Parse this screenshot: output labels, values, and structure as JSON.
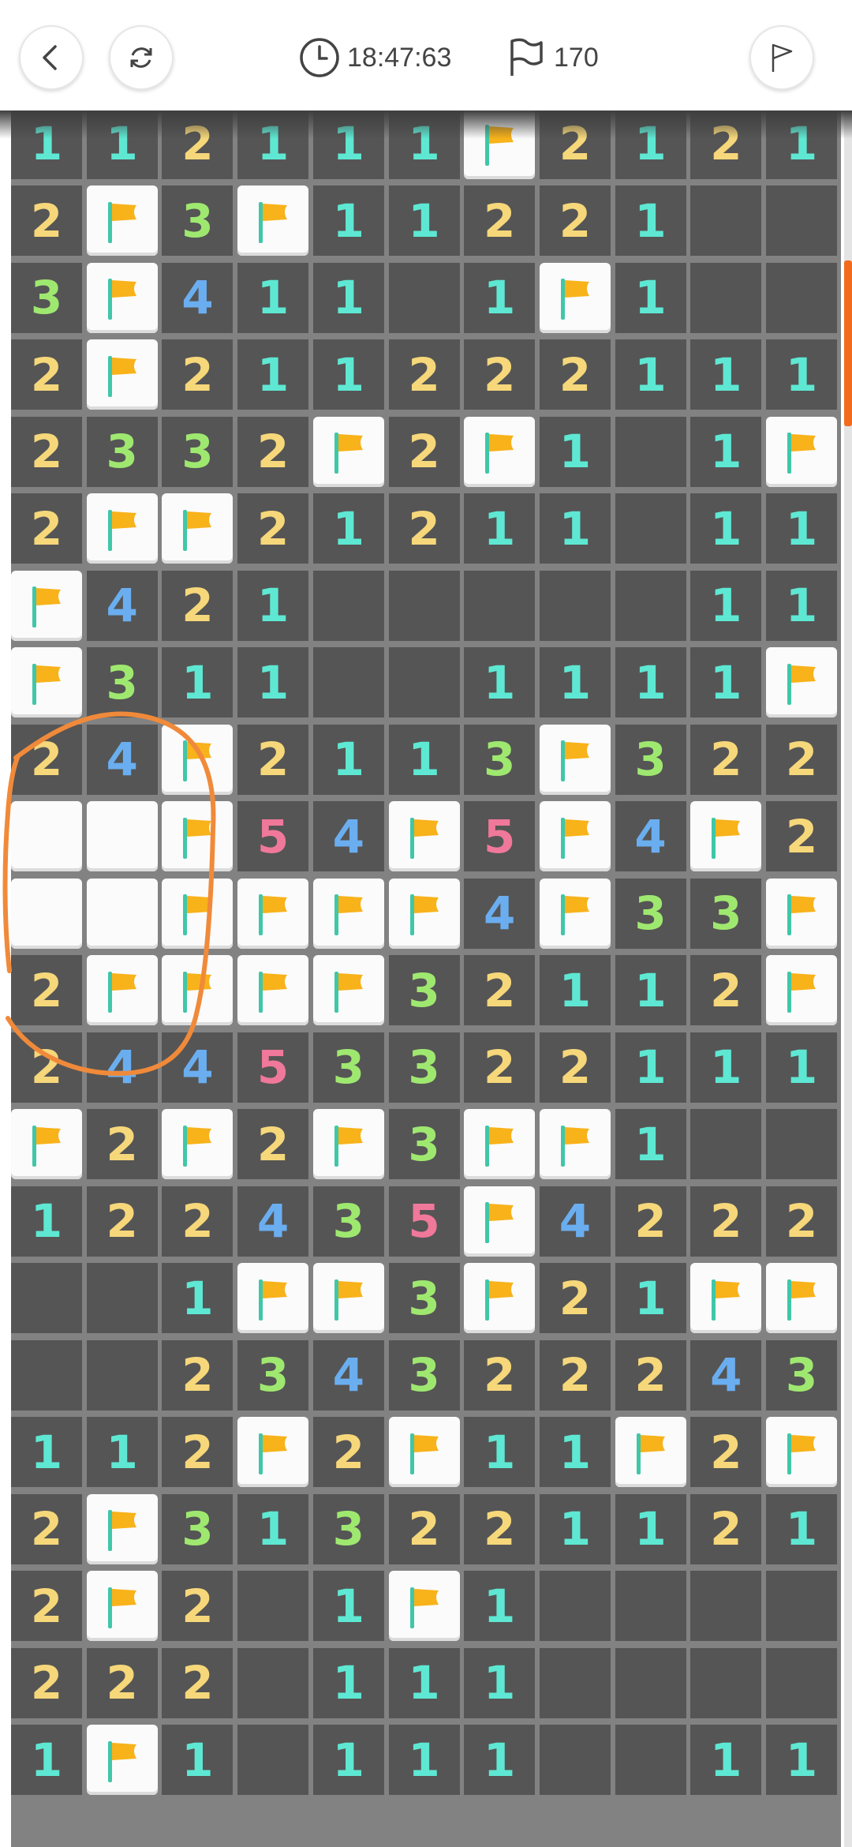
{
  "header": {
    "back_icon": "chevron-left-icon",
    "restart_icon": "refresh-icon",
    "timer_icon": "clock-icon",
    "timer": "18:47:63",
    "flag_icon": "flag-outline-icon",
    "flag_count": "170",
    "flag_mode_icon": "flag-outline-icon"
  },
  "colors": {
    "1": "#5ee8d3",
    "2": "#f6d77a",
    "3": "#9fe870",
    "4": "#6aaef0",
    "5": "#f0789a",
    "open": "#555555",
    "grid": "#828282",
    "accent": "#f26b1d",
    "flag": "#f8b21a",
    "annotation": "#f08a3a"
  },
  "board": {
    "rows": [
      [
        "1",
        "1",
        "2",
        "1",
        "1",
        "1",
        "F",
        "2",
        "1",
        "2",
        "1"
      ],
      [
        "2",
        "F",
        "3",
        "F",
        "1",
        "1",
        "2",
        "2",
        "1",
        "",
        ""
      ],
      [
        "3",
        "F",
        "4",
        "1",
        "1",
        "",
        "1",
        "F",
        "1",
        "",
        ""
      ],
      [
        "2",
        "F",
        "2",
        "1",
        "1",
        "2",
        "2",
        "2",
        "1",
        "1",
        "1"
      ],
      [
        "2",
        "3",
        "3",
        "2",
        "F",
        "2",
        "F",
        "1",
        "",
        "1",
        "F"
      ],
      [
        "2",
        "F",
        "F",
        "2",
        "1",
        "2",
        "1",
        "1",
        "",
        "1",
        "1"
      ],
      [
        "F",
        "4",
        "2",
        "1",
        "",
        "",
        "",
        "",
        "",
        "1",
        "1"
      ],
      [
        "F",
        "3",
        "1",
        "1",
        "",
        "",
        "1",
        "1",
        "1",
        "1",
        "F"
      ],
      [
        "2",
        "4",
        "F",
        "2",
        "1",
        "1",
        "3",
        "F",
        "3",
        "2",
        "2"
      ],
      [
        "H",
        "H",
        "F",
        "5",
        "4",
        "F",
        "5",
        "F",
        "4",
        "F",
        "2"
      ],
      [
        "H",
        "H",
        "F",
        "F",
        "F",
        "F",
        "4",
        "F",
        "3",
        "3",
        "F"
      ],
      [
        "2",
        "F",
        "F",
        "F",
        "F",
        "3",
        "2",
        "1",
        "1",
        "2",
        "F"
      ],
      [
        "2",
        "4",
        "4",
        "5",
        "3",
        "3",
        "2",
        "2",
        "1",
        "1",
        "1"
      ],
      [
        "F",
        "2",
        "F",
        "2",
        "F",
        "3",
        "F",
        "F",
        "1",
        "",
        ""
      ],
      [
        "1",
        "2",
        "2",
        "4",
        "3",
        "5",
        "F",
        "4",
        "2",
        "2",
        "2"
      ],
      [
        "",
        "",
        "1",
        "F",
        "F",
        "3",
        "F",
        "2",
        "1",
        "F",
        "F"
      ],
      [
        "",
        "",
        "2",
        "3",
        "4",
        "3",
        "2",
        "2",
        "2",
        "4",
        "3"
      ],
      [
        "1",
        "1",
        "2",
        "F",
        "2",
        "F",
        "1",
        "1",
        "F",
        "2",
        "F"
      ],
      [
        "2",
        "F",
        "3",
        "1",
        "3",
        "2",
        "2",
        "1",
        "1",
        "2",
        "1"
      ],
      [
        "2",
        "F",
        "2",
        "",
        "1",
        "F",
        "1",
        "",
        "",
        "",
        ""
      ],
      [
        "2",
        "2",
        "2",
        "",
        "1",
        "1",
        "1",
        "",
        "",
        "",
        ""
      ],
      [
        "1",
        "F",
        "1",
        "",
        "1",
        "1",
        "1",
        "",
        "",
        "1",
        "1"
      ]
    ]
  }
}
